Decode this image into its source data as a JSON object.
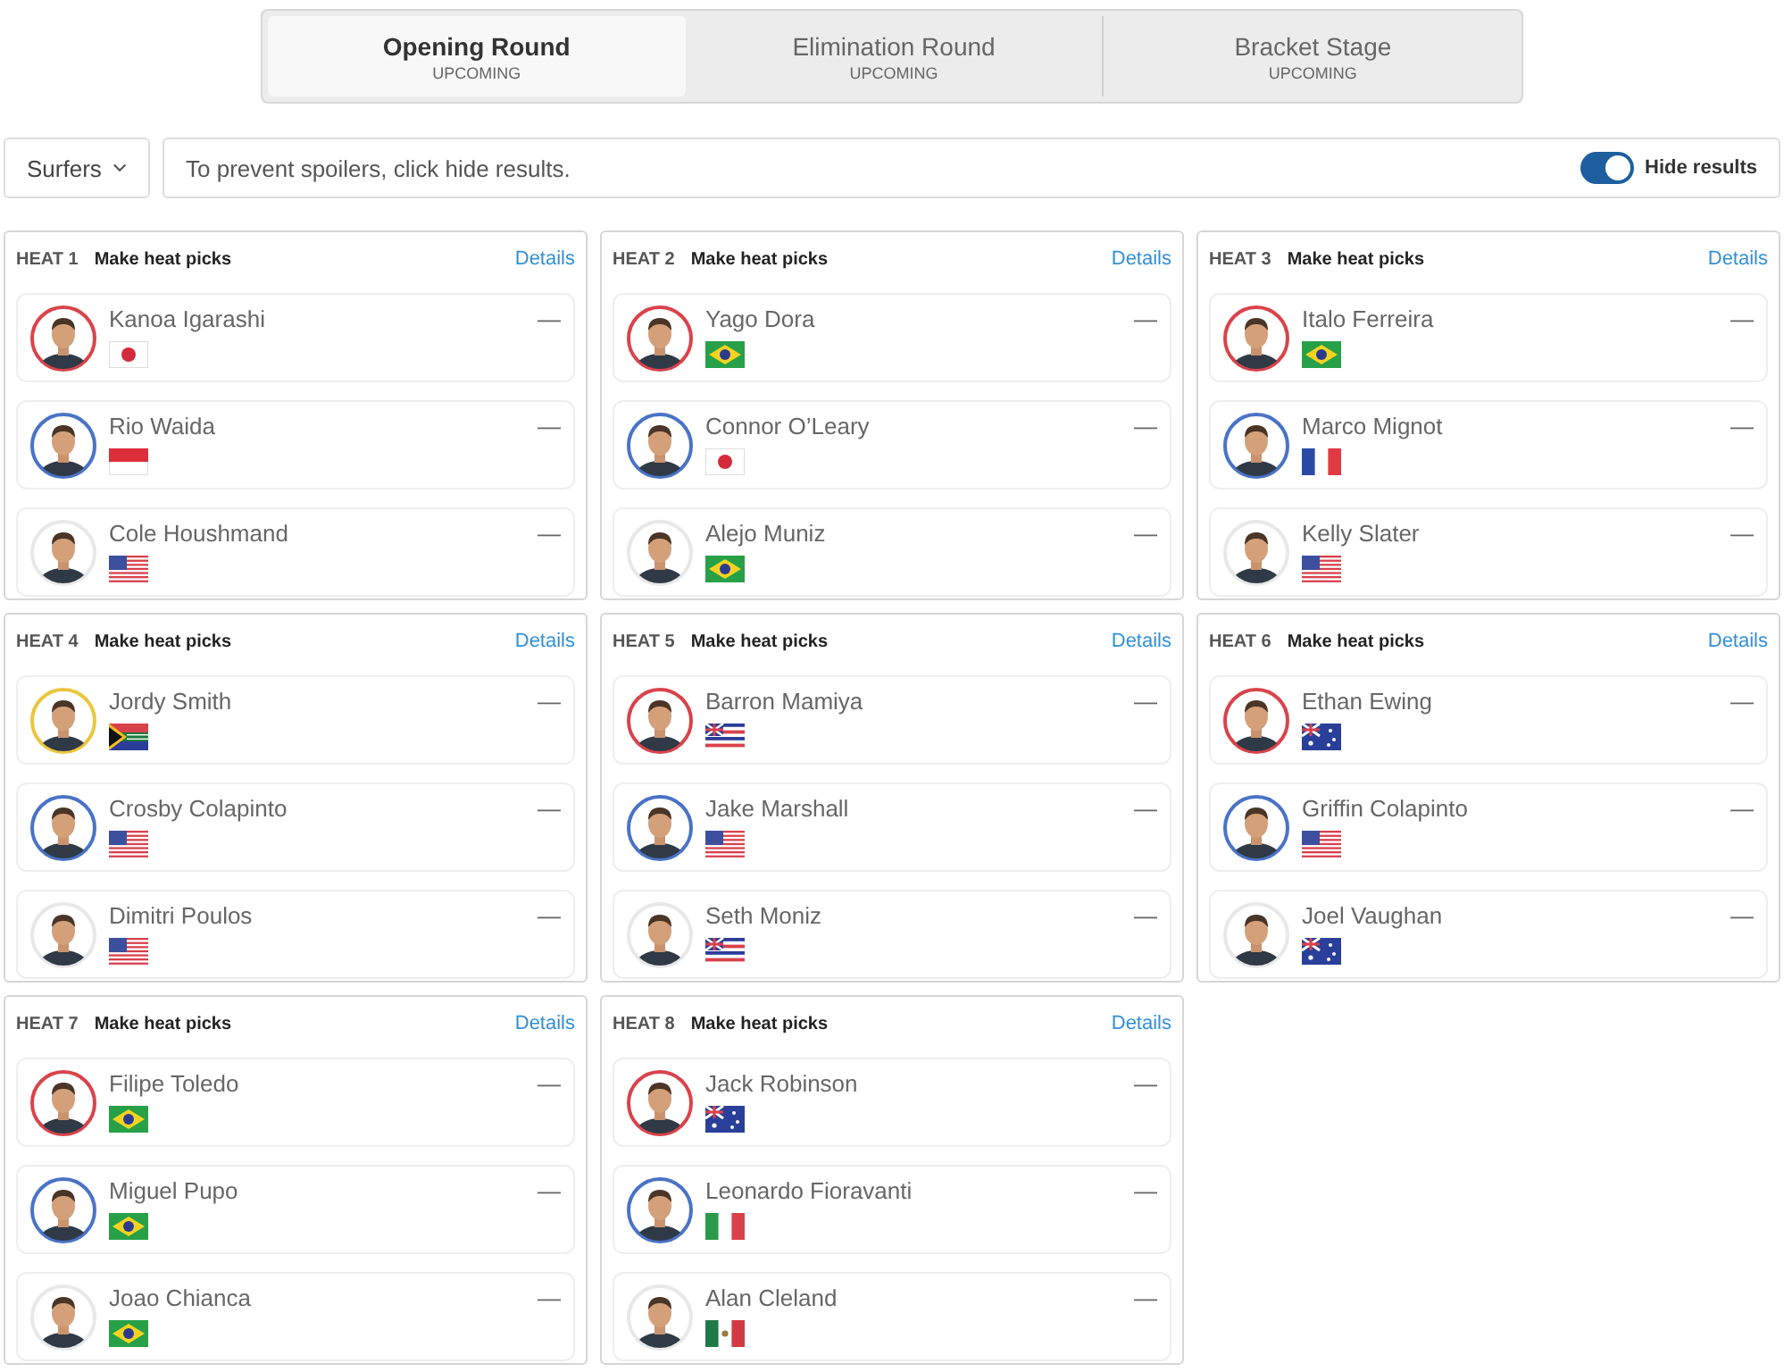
{
  "round_tabs": [
    {
      "label": "Opening Round",
      "status": "UPCOMING",
      "selected": true
    },
    {
      "label": "Elimination Round",
      "status": "UPCOMING",
      "selected": false
    },
    {
      "label": "Bracket Stage",
      "status": "UPCOMING",
      "selected": false
    }
  ],
  "toolbar": {
    "dropdown": "Surfers",
    "notice": "To prevent spoilers, click hide results.",
    "toggle": {
      "label": "Hide results",
      "on": true
    }
  },
  "heats": [
    {
      "title": "HEAT 1",
      "subtitle": "Make heat picks",
      "link": "Details",
      "surfers": [
        {
          "name": "Kanoa Igarashi",
          "kind": "jp",
          "color": "#d9434b",
          "score": "—"
        },
        {
          "name": "Rio Waida",
          "kind": "id",
          "color": "#4a73c6",
          "score": "—"
        },
        {
          "name": "Cole Houshmand",
          "kind": "us",
          "color": "#e8e8e8",
          "score": "—"
        }
      ]
    },
    {
      "title": "HEAT 2",
      "subtitle": "Make heat picks",
      "link": "Details",
      "surfers": [
        {
          "name": "Yago Dora",
          "kind": "br",
          "color": "#d9434b",
          "score": "—"
        },
        {
          "name": "Connor O’Leary",
          "kind": "jp",
          "color": "#4a73c6",
          "score": "—"
        },
        {
          "name": "Alejo Muniz",
          "kind": "br",
          "color": "#e8e8e8",
          "score": "—"
        }
      ]
    },
    {
      "title": "HEAT 3",
      "subtitle": "Make heat picks",
      "link": "Details",
      "surfers": [
        {
          "name": "Italo Ferreira",
          "kind": "br",
          "color": "#d9434b",
          "score": "—"
        },
        {
          "name": "Marco Mignot",
          "kind": "fr",
          "color": "#4a73c6",
          "score": "—"
        },
        {
          "name": "Kelly Slater",
          "kind": "us",
          "color": "#e8e8e8",
          "score": "—"
        }
      ]
    },
    {
      "title": "HEAT 4",
      "subtitle": "Make heat picks",
      "link": "Details",
      "surfers": [
        {
          "name": "Jordy Smith",
          "kind": "za",
          "color": "#e9c63f",
          "score": "—"
        },
        {
          "name": "Crosby Colapinto",
          "kind": "us",
          "color": "#4a73c6",
          "score": "—"
        },
        {
          "name": "Dimitri Poulos",
          "kind": "us",
          "color": "#e8e8e8",
          "score": "—"
        }
      ]
    },
    {
      "title": "HEAT 5",
      "subtitle": "Make heat picks",
      "link": "Details",
      "surfers": [
        {
          "name": "Barron Mamiya",
          "kind": "hi",
          "color": "#d9434b",
          "score": "—"
        },
        {
          "name": "Jake Marshall",
          "kind": "us",
          "color": "#4a73c6",
          "score": "—"
        },
        {
          "name": "Seth Moniz",
          "kind": "hi",
          "color": "#e8e8e8",
          "score": "—"
        }
      ]
    },
    {
      "title": "HEAT 6",
      "subtitle": "Make heat picks",
      "link": "Details",
      "surfers": [
        {
          "name": "Ethan Ewing",
          "kind": "au",
          "color": "#d9434b",
          "score": "—"
        },
        {
          "name": "Griffin Colapinto",
          "kind": "us",
          "color": "#4a73c6",
          "score": "—"
        },
        {
          "name": "Joel Vaughan",
          "kind": "au",
          "color": "#e8e8e8",
          "score": "—"
        }
      ]
    },
    {
      "title": "HEAT 7",
      "subtitle": "Make heat picks",
      "link": "Details",
      "surfers": [
        {
          "name": "Filipe Toledo",
          "kind": "br",
          "color": "#d9434b",
          "score": "—"
        },
        {
          "name": "Miguel Pupo",
          "kind": "br",
          "color": "#4a73c6",
          "score": "—"
        },
        {
          "name": "Joao Chianca",
          "kind": "br",
          "color": "#e8e8e8",
          "score": "—"
        }
      ]
    },
    {
      "title": "HEAT 8",
      "subtitle": "Make heat picks",
      "link": "Details",
      "surfers": [
        {
          "name": "Jack Robinson",
          "kind": "au",
          "color": "#d9434b",
          "score": "—"
        },
        {
          "name": "Leonardo Fioravanti",
          "kind": "it",
          "color": "#4a73c6",
          "score": "—"
        },
        {
          "name": "Alan Cleland",
          "kind": "mx",
          "color": "#e8e8e8",
          "score": "—"
        }
      ]
    }
  ]
}
